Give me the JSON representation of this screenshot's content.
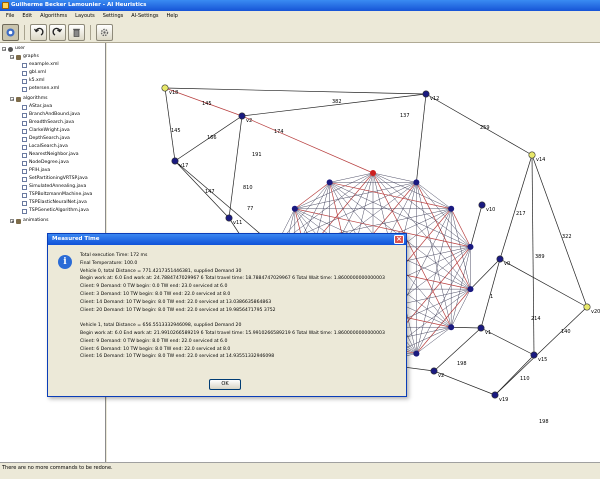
{
  "window": {
    "title": "Guilherme Becker Lamounier - AI Heuristics"
  },
  "menu": [
    "File",
    "Edit",
    "Algorithms",
    "Layouts",
    "Settings",
    "AI-Settings",
    "Help"
  ],
  "toolbar": {
    "icons": [
      "run-icon",
      "undo-icon",
      "redo-icon",
      "delete-icon",
      "settings-icon"
    ]
  },
  "tree": {
    "root": "user",
    "graphs_label": "graphs",
    "graphs": [
      "example.xml",
      "gbl.xml",
      "k5.xml",
      "petersen.xml"
    ],
    "algorithms_label": "algorithms",
    "algorithms": [
      "AStar.java",
      "BranchAndBound.java",
      "BreadthSearch.java",
      "ClarkeWright.java",
      "DepthSearch.java",
      "LocalSearch.java",
      "NearestNeighbor.java",
      "NodeDegree.java",
      "PFIH.java",
      "SetPartitioningVRTSP.java",
      "SimulatedAnnealing.java",
      "TSPBoltzmannMachine.java",
      "TSPElasticNeuralNet.java",
      "TSPGeneticAlgorithm.java"
    ],
    "animations_label": "animations"
  },
  "graph": {
    "nodes": [
      {
        "label": "v18"
      },
      {
        "label": "v2"
      },
      {
        "label": "v12"
      },
      {
        "label": "v17"
      },
      {
        "label": "v11"
      },
      {
        "label": "v14"
      },
      {
        "label": "v0"
      },
      {
        "label": "v10"
      },
      {
        "label": "v1"
      },
      {
        "label": "v15"
      },
      {
        "label": "v20"
      },
      {
        "label": "v2"
      },
      {
        "label": "v19"
      }
    ],
    "edge_labels": [
      "145",
      "382",
      "137",
      "259",
      "174",
      "166",
      "145",
      "191",
      "147",
      "810",
      "77",
      "217",
      "322",
      "389",
      "214",
      "140",
      "198",
      "110",
      "198",
      "1"
    ]
  },
  "dialog": {
    "title": "Measured Time",
    "lines": [
      "Total execution Time: 172 ms",
      "Final Temperature: 100.0",
      "Vehicle 0, total Distance = 771.4217351446381, supplied Demand 30",
      "  Begin work at: 6.0 End work at: 24.7884747029967 6 Total travel time: 18.7884747029967 6 Total Wait time: 1.8600000000000003",
      "  Client: 9 Demand: 0 TW begin: 0.0 TW end: 23.0 serviced at 6.0",
      "  Client: 3 Demand: 10 TW begin: 8.0 TW end: 22.0 serviced at 8.0",
      "  Client: 14 Demand: 10 TW begin: 8.0 TW end: 22.0 serviced at 13.0386635864863",
      "  Client: 20 Demand: 10 TW begin: 8.0 TW end: 22.0 serviced at 19.9856471795 3752",
      "",
      "Vehicle 1, total Distance = 656.5513332946098, supplied Demand 20",
      "  Begin work at: 6.0 End work at: 21.9910266589219 6 Total travel time: 15.9910266589219 6 Total Wait time: 1.8600000000000003",
      "  Client: 9 Demand: 0 TW begin: 8.0 TW end: 22.0 serviced at 6.0",
      "  Client: 6 Demand: 10 TW begin: 8.0 TW end: 22.0 serviced at 8.0",
      "  Client: 16 Demand: 10 TW begin: 8.0 TW end: 22.0 serviced at 14.93551332946098"
    ],
    "ok_label": "OK"
  },
  "status": {
    "text": "There are no more commands to be redone."
  },
  "colors": {
    "node": "#1a1a80",
    "node_yellow": "#e8e86a",
    "node_red": "#cc2020",
    "edge_red": "#b84040",
    "titlebar": "#1654d6"
  }
}
